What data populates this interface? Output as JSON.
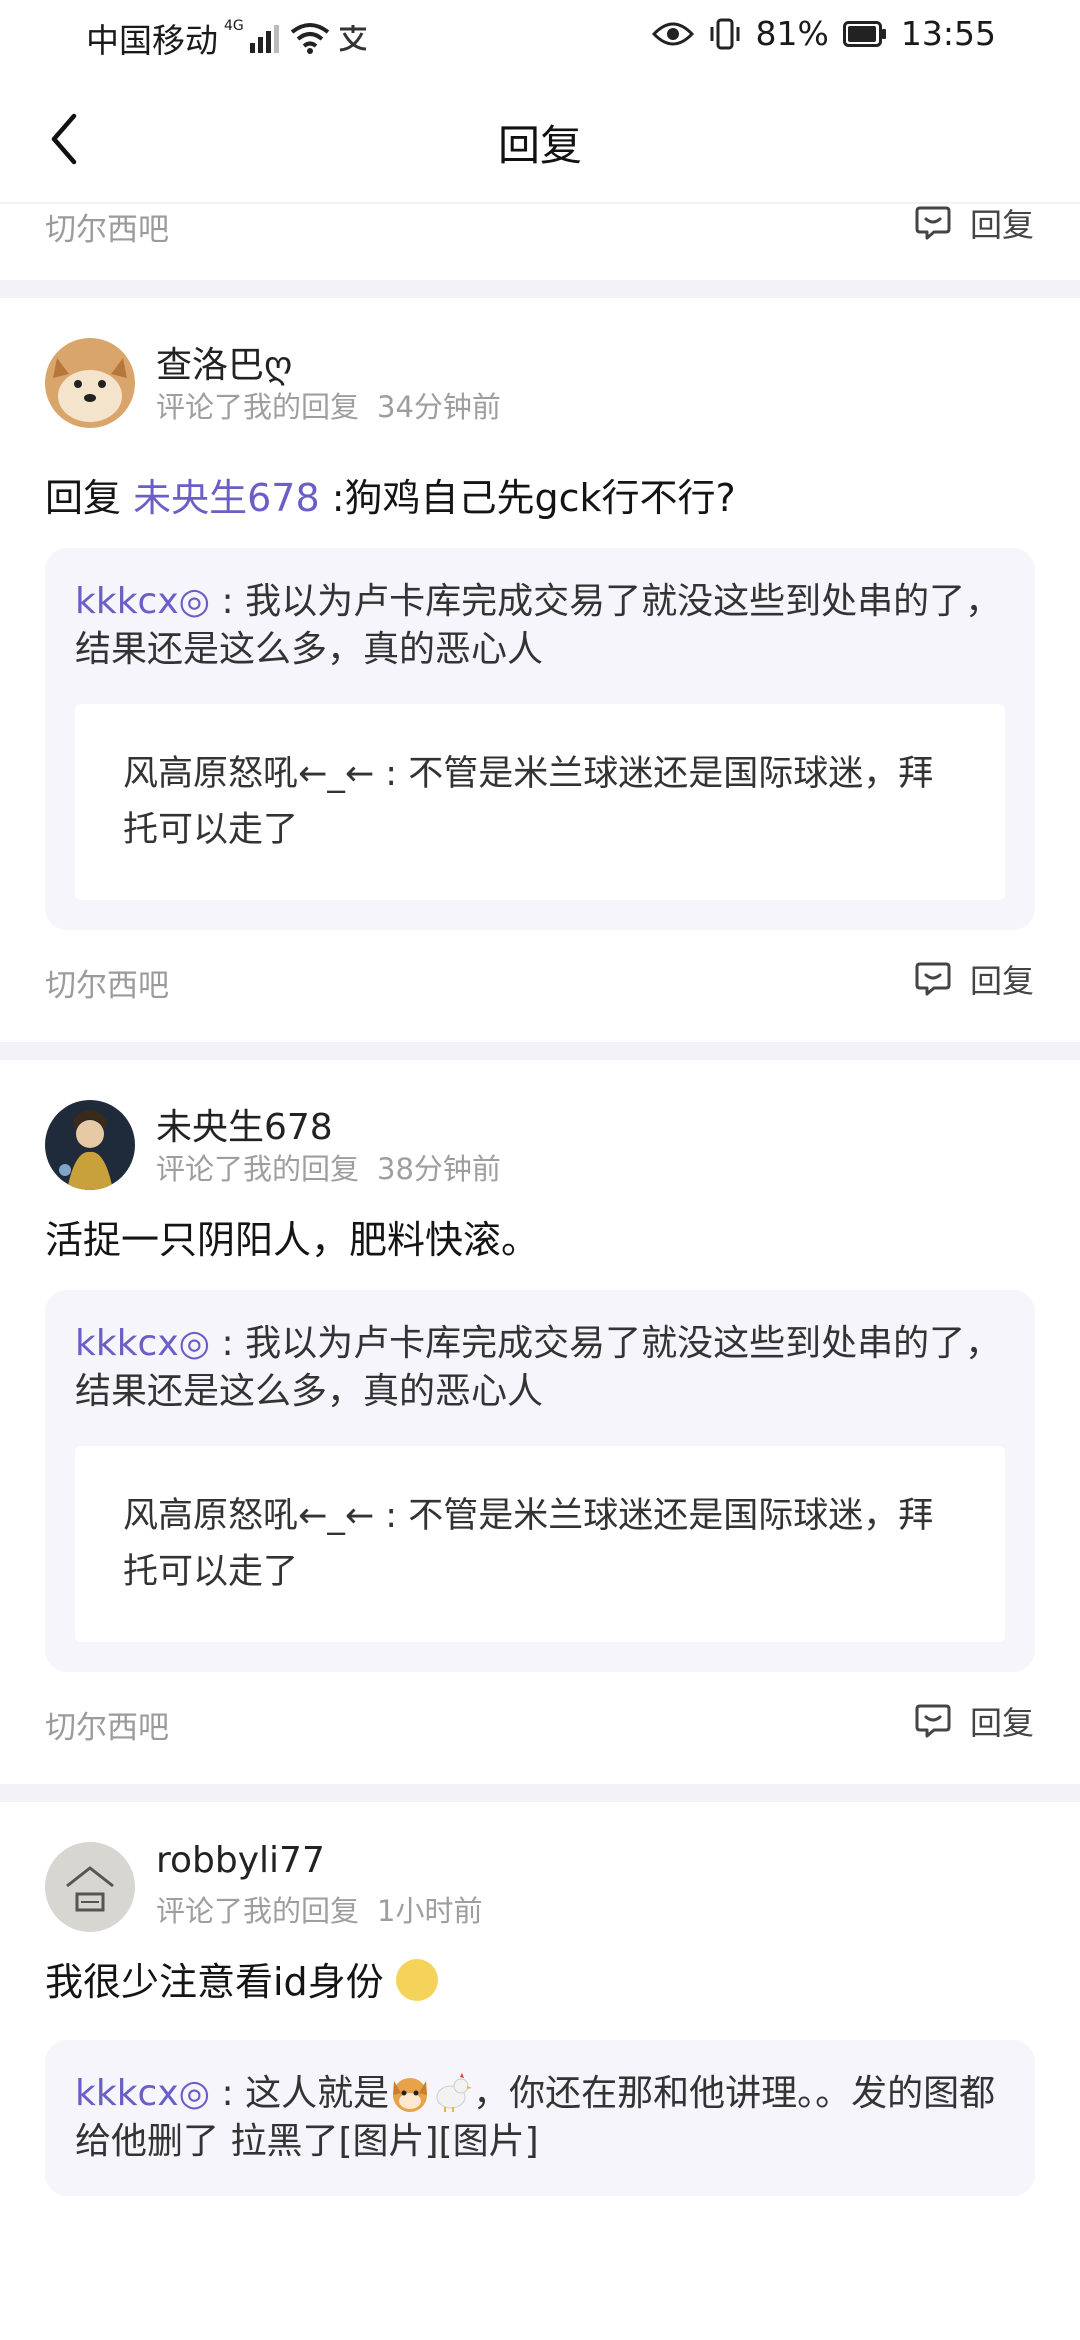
{
  "status_bar": {
    "carrier": "中国移动",
    "network": "4G",
    "battery": "81%",
    "time": "13:55"
  },
  "nav": {
    "title": "回复"
  },
  "top_footer": {
    "forum": "切尔西吧",
    "reply_label": "回复"
  },
  "posts": [
    {
      "username": "查洛巴ღ",
      "action": "评论了我的回复",
      "time": "34分钟前",
      "content_prefix": "回复 ",
      "mention": "未央生678",
      "content": " :狗鸡自己先gck行不行?",
      "quote_user": "kkkcx◎",
      "quote_text": " : 我以为卢卡库完成交易了就没这些到处串的了，结果还是这么多，真的恶心人",
      "inner_quote": "风高原怒吼←_← : 不管是米兰球迷还是国际球迷，拜托可以走了",
      "forum": "切尔西吧",
      "reply_label": "回复"
    },
    {
      "username": "未央生678",
      "action": "评论了我的回复",
      "time": "38分钟前",
      "content": "活捉一只阴阳人，肥料快滚。",
      "quote_user": "kkkcx◎",
      "quote_text": " : 我以为卢卡库完成交易了就没这些到处串的了，结果还是这么多，真的恶心人",
      "inner_quote": "风高原怒吼←_← : 不管是米兰球迷还是国际球迷，拜托可以走了",
      "forum": "切尔西吧",
      "reply_label": "回复"
    },
    {
      "username": "robbyli77",
      "action": "评论了我的回复",
      "time": "1小时前",
      "content": "我很少注意看id身份",
      "quote_user": "kkkcx◎",
      "quote_text_a": " : 这人就是",
      "quote_text_b": "，你还在那和他讲理。。发的图都给他删了 拉黑了[图片][图片]"
    }
  ]
}
